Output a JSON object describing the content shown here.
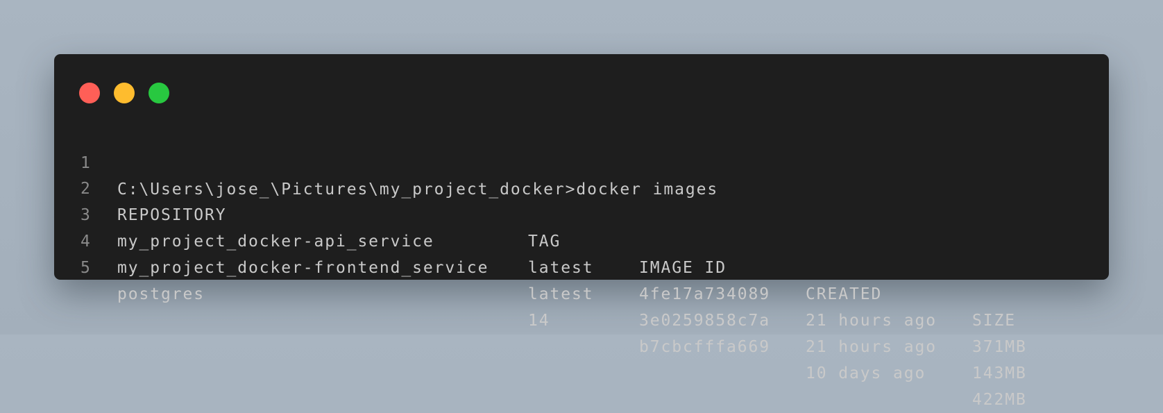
{
  "window": {
    "controls": [
      {
        "name": "close",
        "color": "#ff5f57"
      },
      {
        "name": "minimize",
        "color": "#febc2e"
      },
      {
        "name": "maximize",
        "color": "#28c840"
      }
    ]
  },
  "terminal": {
    "line_numbers": [
      "1",
      "2",
      "3",
      "4",
      "5"
    ],
    "command": "C:\\Users\\jose_\\Pictures\\my_project_docker>docker images",
    "headers": [
      "REPOSITORY",
      "TAG",
      "IMAGE ID",
      "CREATED",
      "SIZE"
    ],
    "rows": [
      [
        "my_project_docker-api_service",
        "latest",
        "4fe17a734089",
        "21 hours ago",
        "371MB"
      ],
      [
        "my_project_docker-frontend_service",
        "latest",
        "3e0259858c7a",
        "21 hours ago",
        "143MB"
      ],
      [
        "postgres",
        "14",
        "b7cbcfffa669",
        "10 days ago",
        "422MB"
      ]
    ]
  }
}
